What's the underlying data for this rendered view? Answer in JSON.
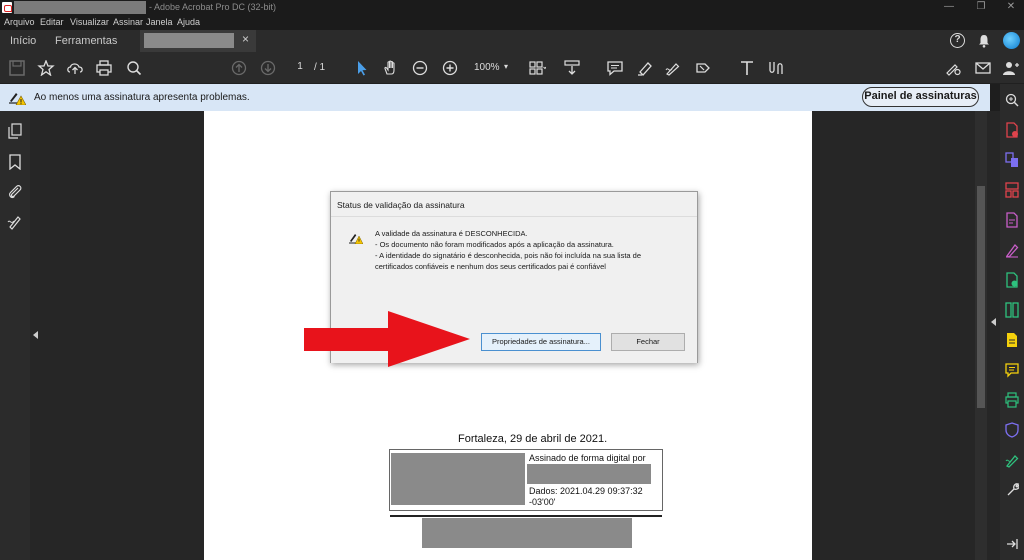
{
  "window": {
    "title": "- Adobe Acrobat Pro DC (32-bit)",
    "minimize": "—",
    "restore": "❐",
    "close": "✕"
  },
  "menu": [
    "Arquivo",
    "Editar",
    "Visualizar",
    "Assinar",
    "Janela",
    "Ajuda"
  ],
  "tabs": {
    "home": "Início",
    "tools": "Ferramentas",
    "doc_close": "×"
  },
  "header": {
    "help": "?"
  },
  "toolbar": {
    "page_current": "1",
    "page_total": "/ 1",
    "zoom": "100%",
    "zoom_caret": "▾"
  },
  "notice": {
    "text": "Ao menos uma assinatura apresenta problemas.",
    "button": "Painel de assinaturas"
  },
  "dialog": {
    "title": "Status de validação da assinatura",
    "lines": [
      "A validade da assinatura é DESCONHECIDA.",
      "- Os documento não foram modificados após a aplicação da assinatura.",
      "- A identidade do signatário é desconhecida, pois não foi incluída na sua lista de",
      "certificados confiáveis e nenhum dos seus certificados pai é confiável"
    ],
    "btn_properties": "Propriedades de assinatura...",
    "btn_close": "Fechar"
  },
  "document": {
    "city_date": "Fortaleza, 29 de abril de 2021.",
    "sig_title": "Assinado de forma digital por",
    "sig_date": "Dados: 2021.04.29 09:37:32 -03'00'"
  },
  "colors": {
    "notice_bg": "#d8e6f6",
    "arrow": "#e8131b",
    "accent": "#4a90d0"
  }
}
